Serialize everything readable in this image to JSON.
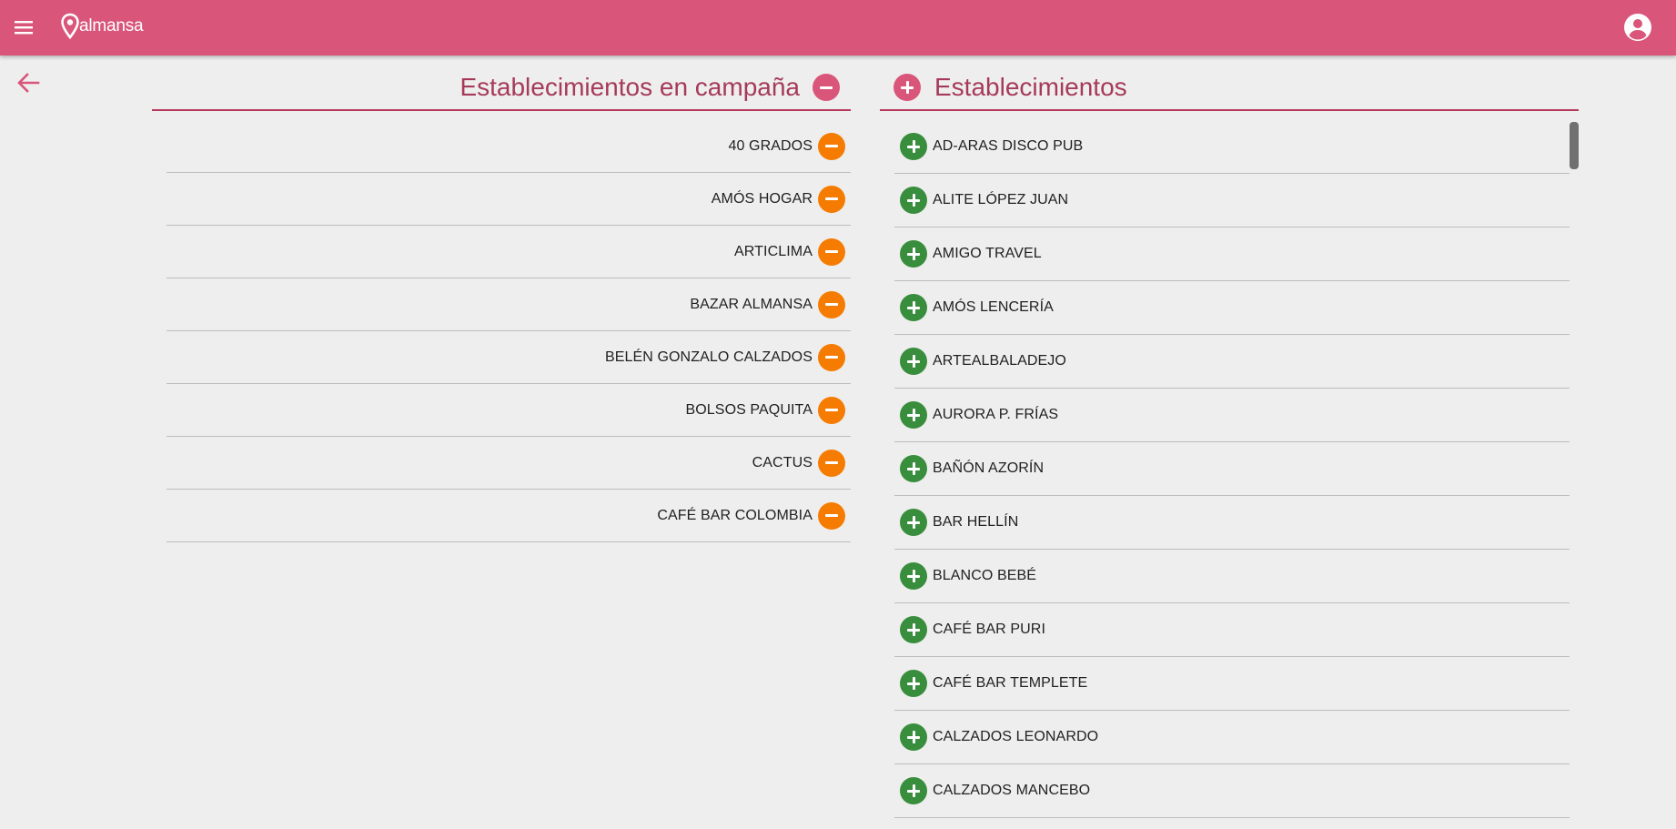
{
  "app": {
    "brand": "almansa",
    "colors": {
      "primary": "#d9557a",
      "title": "#a63a5a",
      "remove": "#f57c00",
      "add": "#388e3c",
      "background": "#eeeeee"
    },
    "icons": {
      "menu": "menu-icon",
      "logo": "location-pin-icon",
      "account": "account-circle-icon",
      "back": "arrow-left-icon"
    }
  },
  "campaign": {
    "title": "Establecimientos en campaña",
    "header_icon": "minus-circle-icon",
    "row_icon": "minus-circle-icon",
    "items": [
      {
        "label": "40 GRADOS"
      },
      {
        "label": "AMÓS HOGAR"
      },
      {
        "label": "ARTICLIMA"
      },
      {
        "label": "BAZAR ALMANSA"
      },
      {
        "label": "BELÉN GONZALO CALZADOS"
      },
      {
        "label": "BOLSOS PAQUITA"
      },
      {
        "label": "CACTUS"
      },
      {
        "label": "CAFÉ BAR COLOMBIA"
      }
    ]
  },
  "establishments": {
    "title": "Establecimientos",
    "header_icon": "plus-circle-icon",
    "row_icon": "plus-circle-icon",
    "items": [
      {
        "label": "AD-ARAS DISCO PUB"
      },
      {
        "label": "ALITE LÓPEZ JUAN"
      },
      {
        "label": "AMIGO TRAVEL"
      },
      {
        "label": "AMÓS LENCERÍA"
      },
      {
        "label": "ARTEALBALADEJO"
      },
      {
        "label": "AURORA P. FRÍAS"
      },
      {
        "label": "BAÑÓN AZORÍN"
      },
      {
        "label": "BAR HELLÍN"
      },
      {
        "label": "BLANCO BEBÉ"
      },
      {
        "label": "CAFÉ BAR PURI"
      },
      {
        "label": "CAFÉ BAR TEMPLETE"
      },
      {
        "label": "CALZADOS LEONARDO"
      },
      {
        "label": "CALZADOS MANCEBO"
      }
    ]
  }
}
